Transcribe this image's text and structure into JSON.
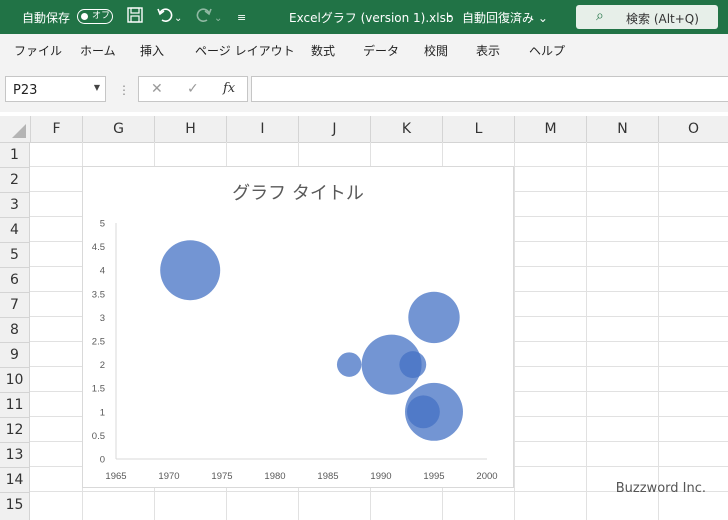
{
  "titlebar": {
    "autosave_label": "自動保存",
    "autosave_state": "オフ",
    "document_title": "Excelグラフ (version 1).xlsb",
    "save_status": "自動回復済み ⌄",
    "search_label": "検索 (Alt+Q)",
    "icons": [
      "save-icon",
      "undo-icon",
      "redo-icon",
      "customize-icon",
      "search-icon"
    ]
  },
  "menu": [
    "ファイル",
    "ホーム",
    "挿入",
    "ページ レイアウト",
    "数式",
    "データ",
    "校閲",
    "表示",
    "ヘルプ"
  ],
  "formula_bar": {
    "name_box": "P23",
    "cancel_glyph": "✕",
    "enter_glyph": "✓",
    "fx_label": "fx",
    "formula": ""
  },
  "sheet": {
    "columns": [
      "F",
      "G",
      "H",
      "I",
      "J",
      "K",
      "L",
      "M",
      "N",
      "O"
    ],
    "rows": [
      "1",
      "2",
      "3",
      "4",
      "5",
      "6",
      "7",
      "8",
      "9",
      "10",
      "11",
      "12",
      "13",
      "14",
      "15"
    ]
  },
  "chart_data": {
    "type": "scatter",
    "title": "グラフ タイトル",
    "xlabel": "",
    "ylabel": "",
    "xlim": [
      1965,
      2000
    ],
    "ylim": [
      0,
      5
    ],
    "x_ticks": [
      "1965",
      "1970",
      "1975",
      "1980",
      "1985",
      "1990",
      "1995",
      "2000"
    ],
    "y_ticks": [
      "0",
      "0.5",
      "1",
      "1.5",
      "2",
      "2.5",
      "3",
      "3.5",
      "4",
      "4.5",
      "5"
    ],
    "grid": false,
    "bubble_color": "#4472c4",
    "points": [
      {
        "x": 1972,
        "y": 4,
        "size": 3.0
      },
      {
        "x": 1995,
        "y": 3,
        "size": 2.2
      },
      {
        "x": 1987,
        "y": 2,
        "size": 0.5
      },
      {
        "x": 1991,
        "y": 2,
        "size": 3.0
      },
      {
        "x": 1993,
        "y": 2,
        "size": 0.6
      },
      {
        "x": 1995,
        "y": 1,
        "size": 2.8
      },
      {
        "x": 1994,
        "y": 1,
        "size": 0.9
      }
    ]
  },
  "watermark": "Buzzword Inc."
}
